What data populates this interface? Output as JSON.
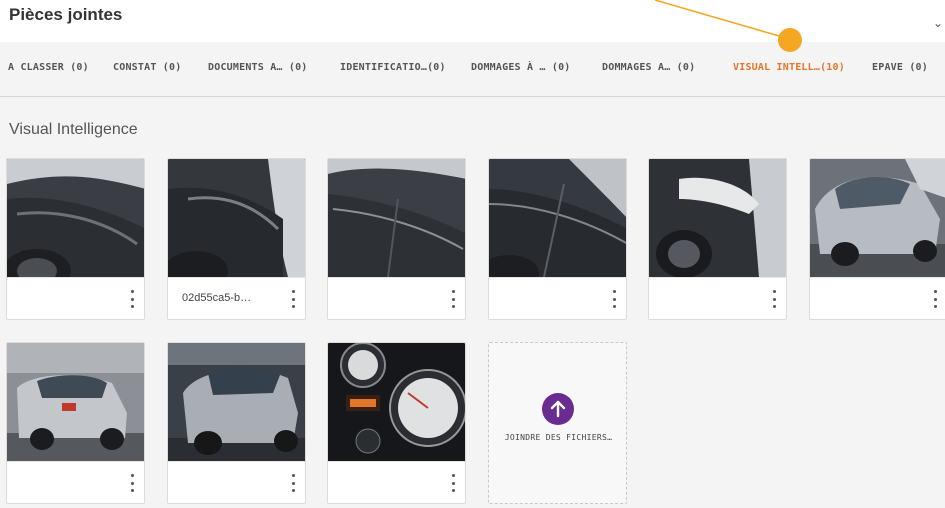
{
  "header": {
    "title": "Pièces jointes",
    "right_glyph": "⌄"
  },
  "tabs": [
    {
      "label": "A CLASSER (0)",
      "active": false
    },
    {
      "label": "CONSTAT (0)",
      "active": false
    },
    {
      "label": "DOCUMENTS A… (0)",
      "active": false
    },
    {
      "label": "IDENTIFICATIO…(0)",
      "active": false
    },
    {
      "label": "DOMMAGES À … (0)",
      "active": false
    },
    {
      "label": "DOMMAGES A… (0)",
      "active": false
    },
    {
      "label": "VISUAL INTELL…(10)",
      "active": true
    },
    {
      "label": "EPAVE (0)",
      "active": false
    }
  ],
  "section": {
    "title": "Visual Intelligence"
  },
  "attachments": [
    {
      "name": "",
      "icon": "photo-thumbnail"
    },
    {
      "name": "02d55ca5-b…",
      "icon": "photo-thumbnail"
    },
    {
      "name": "",
      "icon": "photo-thumbnail"
    },
    {
      "name": "",
      "icon": "photo-thumbnail"
    },
    {
      "name": "",
      "icon": "photo-thumbnail"
    },
    {
      "name": "",
      "icon": "photo-thumbnail"
    },
    {
      "name": "",
      "icon": "photo-thumbnail"
    },
    {
      "name": "",
      "icon": "photo-thumbnail"
    },
    {
      "name": "",
      "icon": "photo-thumbnail"
    }
  ],
  "upload": {
    "label": "JOINDRE DES FICHIERS…",
    "icon": "arrow-up-icon"
  },
  "colors": {
    "accent": "#e8742a",
    "annotation": "#f5a623",
    "upload_button": "#6a2c91"
  }
}
